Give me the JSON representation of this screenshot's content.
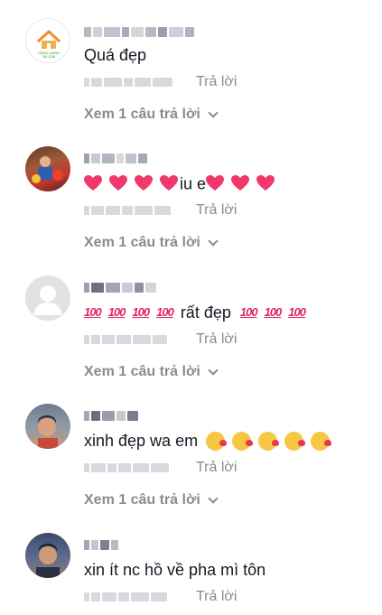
{
  "comments": [
    {
      "text": "Quá đẹp",
      "reply_label": "Trả lời",
      "view_replies": "Xem 1 câu trả lời"
    },
    {
      "text_suffix": "iu e",
      "reply_label": "Trả lời",
      "view_replies": "Xem 1 câu trả lời"
    },
    {
      "text_middle": "rất đẹp",
      "hundred_glyph": "100",
      "reply_label": "Trả lời",
      "view_replies": "Xem 1 câu trả lời"
    },
    {
      "text": "xinh đẹp wa em",
      "reply_label": "Trả lời",
      "view_replies": "Xem 1 câu trả lời"
    },
    {
      "text": "xin ít nc hồ về pha mì tôn",
      "reply_label": "Trả lời"
    }
  ],
  "colors": {
    "muted": "#8a8b91",
    "text": "#161823",
    "heart": "#f0386b"
  },
  "icons": [
    "house-logo-avatar",
    "heart-emoji",
    "hundred-points-emoji",
    "kiss-face-emoji",
    "chevron-down-icon"
  ]
}
